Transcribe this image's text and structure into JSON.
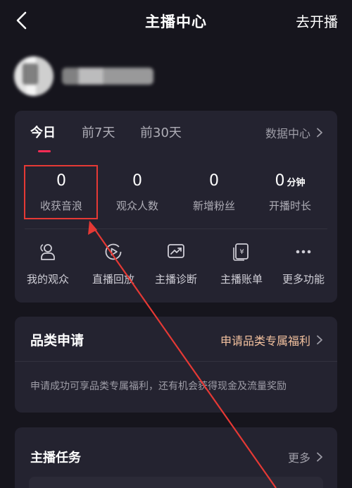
{
  "nav": {
    "title": "主播中心",
    "action": "去开播"
  },
  "tabs": [
    "今日",
    "前7天",
    "前30天"
  ],
  "data_center": "数据中心",
  "stats": [
    {
      "value": "0",
      "unit": "",
      "label": "收获音浪"
    },
    {
      "value": "0",
      "unit": "",
      "label": "观众人数"
    },
    {
      "value": "0",
      "unit": "",
      "label": "新增粉丝"
    },
    {
      "value": "0",
      "unit": "分钟",
      "label": "开播时长"
    }
  ],
  "tools": [
    {
      "label": "我的观众",
      "icon": "audience-icon"
    },
    {
      "label": "直播回放",
      "icon": "replay-icon"
    },
    {
      "label": "主播诊断",
      "icon": "diagnosis-icon"
    },
    {
      "label": "主播账单",
      "icon": "bill-icon"
    },
    {
      "label": "更多功能",
      "icon": "more-icon"
    }
  ],
  "category": {
    "title": "品类申请",
    "link": "申请品类专属福利",
    "desc": "申请成功可享品类专属福利，还有机会获得现金及流量奖励"
  },
  "tasks": {
    "title": "主播任务",
    "link": "更多"
  },
  "colors": {
    "background": "#16151d",
    "card": "#242330",
    "accent": "#fe2c55",
    "highlight_box": "#e53935",
    "link_warm": "#f5c3a0"
  }
}
